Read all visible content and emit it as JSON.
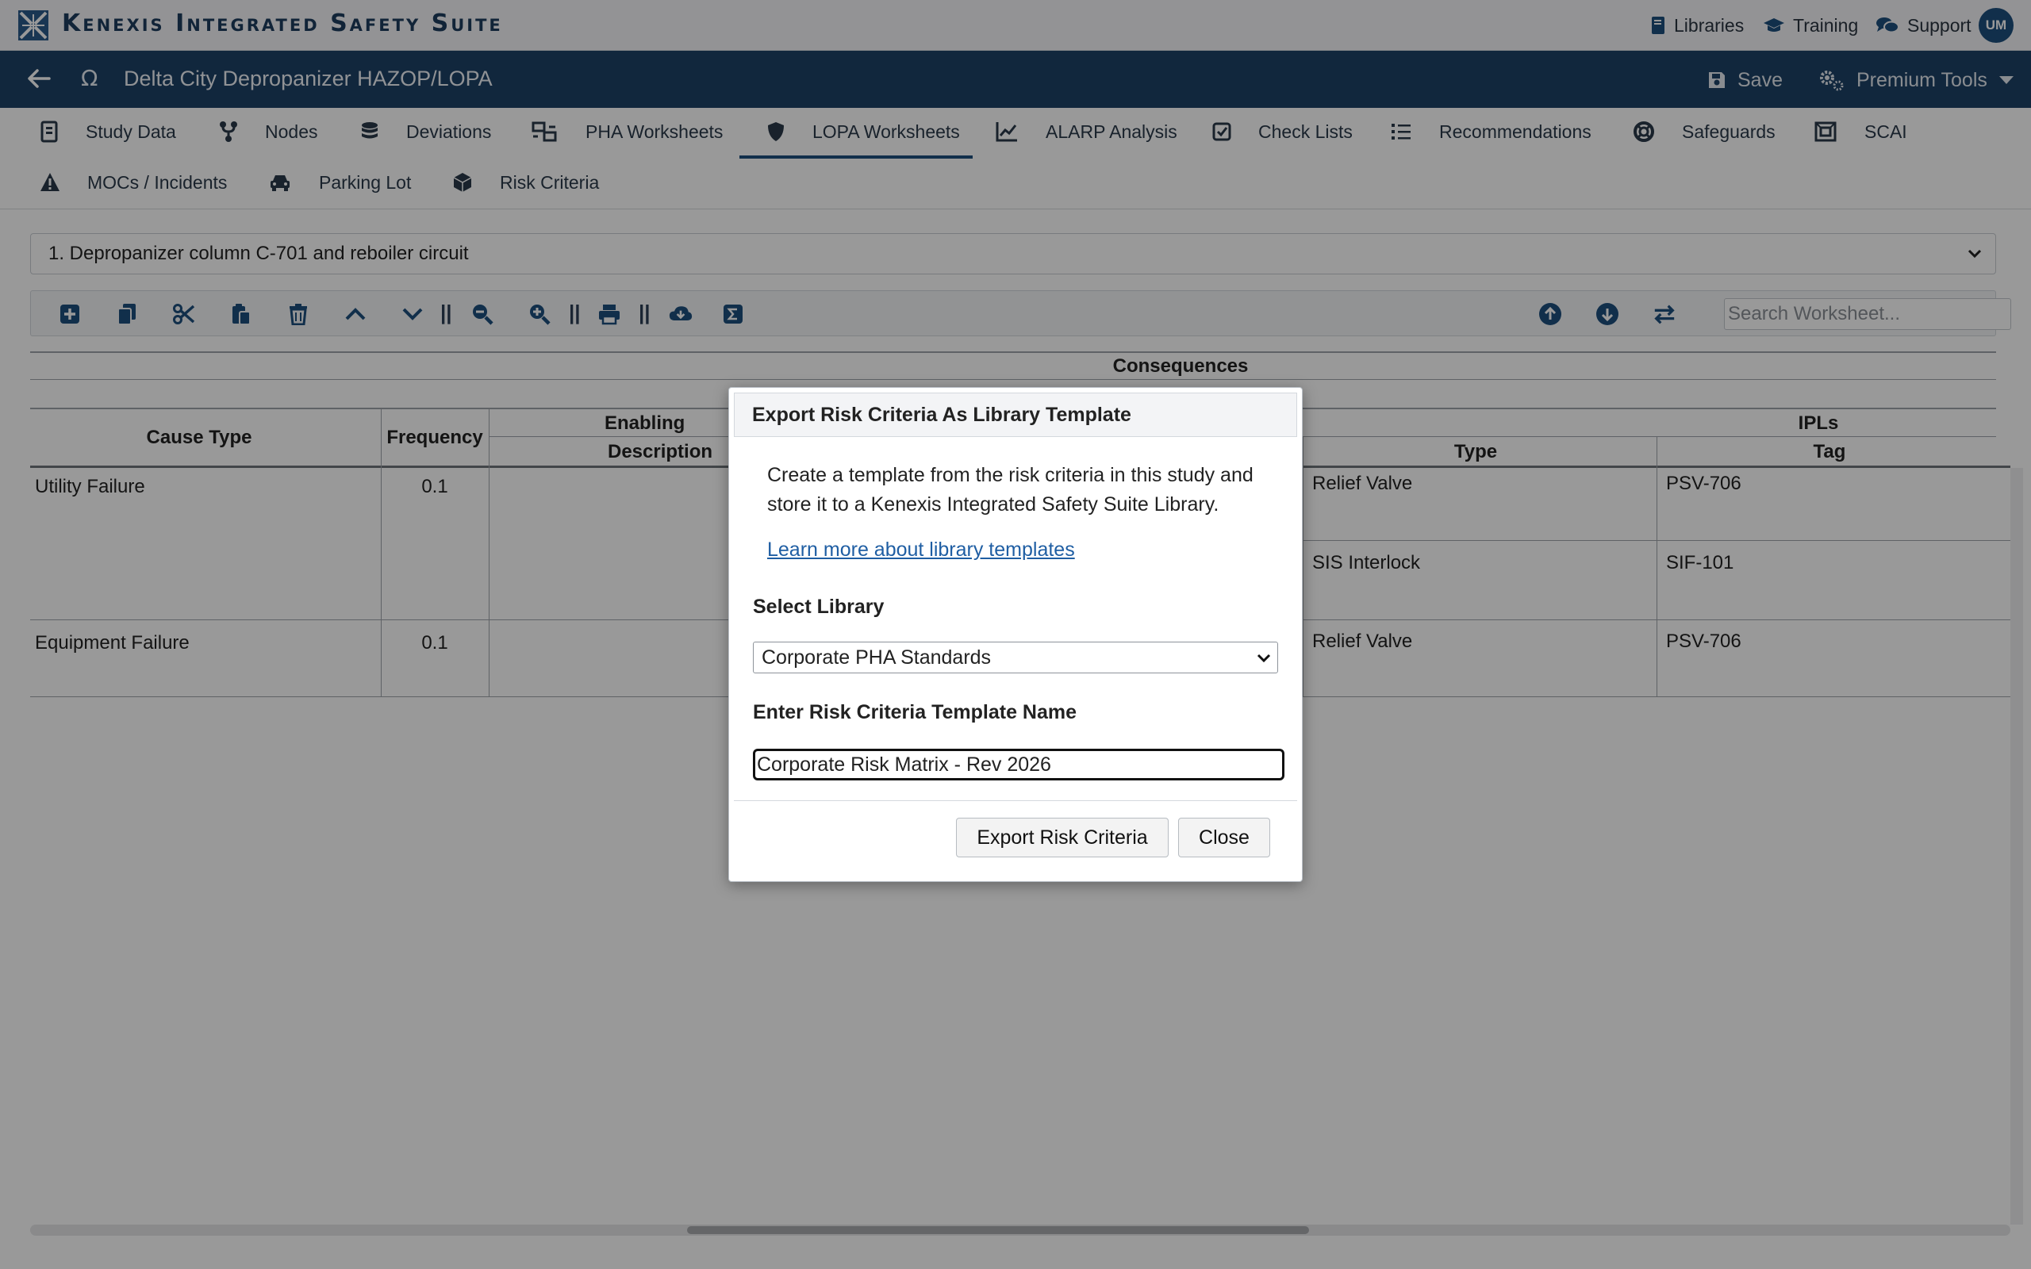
{
  "app": {
    "title": "Kenexis Integrated Safety Suite"
  },
  "topbar": {
    "links": [
      {
        "label": "Libraries",
        "icon": "book-icon"
      },
      {
        "label": "Training",
        "icon": "graduation-cap-icon"
      },
      {
        "label": "Support",
        "icon": "comments-icon"
      }
    ],
    "user_initials": "UM"
  },
  "study": {
    "omega": "Ω",
    "title": "Delta City Depropanizer HAZOP/LOPA",
    "save_label": "Save",
    "premium_label": "Premium Tools"
  },
  "nav": {
    "tabs": [
      {
        "label": "Study Data",
        "icon": "study-data-icon",
        "active": false
      },
      {
        "label": "Nodes",
        "icon": "nodes-icon",
        "active": false
      },
      {
        "label": "Deviations",
        "icon": "database-icon",
        "active": false
      },
      {
        "label": "PHA Worksheets",
        "icon": "worksheet-icon",
        "active": false
      },
      {
        "label": "LOPA Worksheets",
        "icon": "shield-icon",
        "active": true
      },
      {
        "label": "ALARP Analysis",
        "icon": "chart-line-icon",
        "active": false
      },
      {
        "label": "Check Lists",
        "icon": "checkbox-icon",
        "active": false
      },
      {
        "label": "Recommendations",
        "icon": "list-icon",
        "active": false
      },
      {
        "label": "Safeguards",
        "icon": "life-ring-icon",
        "active": false
      },
      {
        "label": "SCAI",
        "icon": "scai-icon",
        "active": false
      },
      {
        "label": "MOCs / Incidents",
        "icon": "warning-icon",
        "active": false
      },
      {
        "label": "Parking Lot",
        "icon": "car-icon",
        "active": false
      },
      {
        "label": "Risk Criteria",
        "icon": "cube-icon",
        "active": false
      }
    ]
  },
  "node_select": {
    "value": "1. Depropanizer column C-701 and reboiler circuit"
  },
  "toolbar": {
    "separator": "||",
    "search_placeholder": "Search Worksheet..."
  },
  "grid": {
    "group_header": "Consequences",
    "headers": {
      "cause_type": "Cause Type",
      "frequency": "Frequency",
      "enabling": "Enabling",
      "description": "Description",
      "ipls": "IPLs",
      "type": "Type",
      "tag": "Tag"
    },
    "rows": [
      {
        "cause_type": "Utility Failure",
        "frequency": "0.1",
        "ipls": [
          {
            "type": "Relief Valve",
            "tag": "PSV-706"
          },
          {
            "type": "SIS Interlock",
            "tag": "SIF-101"
          }
        ]
      },
      {
        "cause_type": "Equipment Failure",
        "frequency": "0.1",
        "ipls": [
          {
            "type": "Relief Valve",
            "tag": "PSV-706"
          }
        ]
      }
    ]
  },
  "modal": {
    "title": "Export Risk Criteria As Library Template",
    "description": "Create a template from the risk criteria in this study and store it to a Kenexis Integrated Safety Suite Library.",
    "link": "Learn more about library templates",
    "library_label": "Select Library",
    "library_value": "Corporate PHA Standards",
    "name_label": "Enter Risk Criteria Template Name",
    "name_value": "Corporate Risk Matrix - Rev 2026",
    "export_button": "Export Risk Criteria",
    "close_button": "Close"
  },
  "colors": {
    "brand_navy": "#1d4166",
    "accent_blue": "#1d4f7d",
    "overlay": "rgba(0,0,0,0.4)"
  }
}
